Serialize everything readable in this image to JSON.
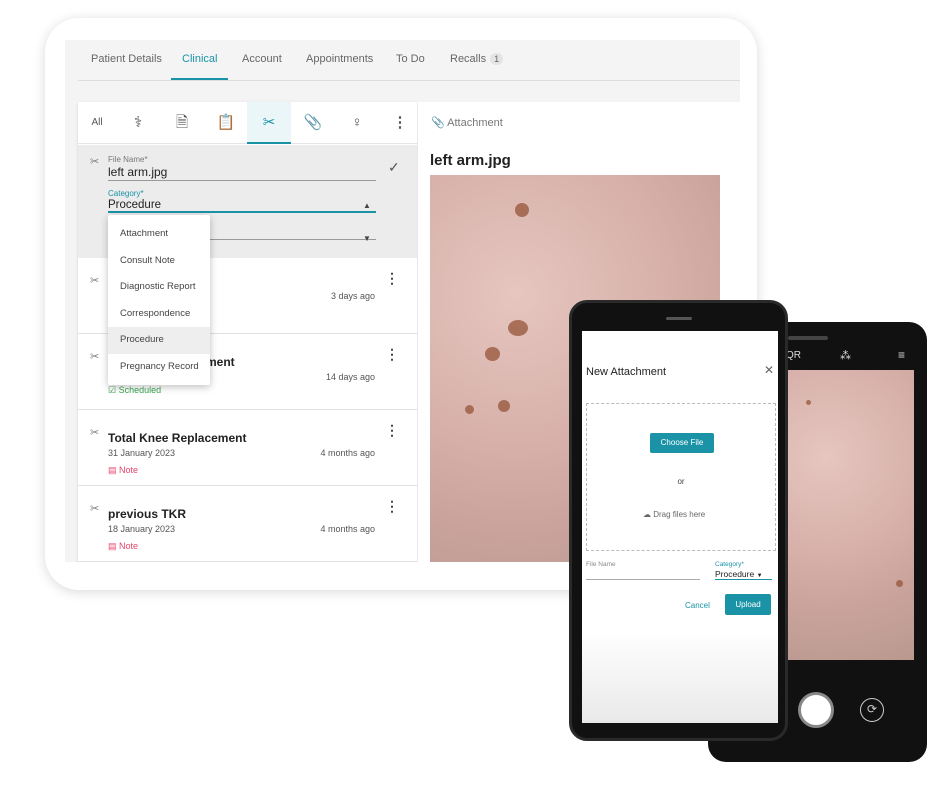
{
  "tabs": [
    {
      "label": "Patient Details"
    },
    {
      "label": "Clinical"
    },
    {
      "label": "Account"
    },
    {
      "label": "Appointments"
    },
    {
      "label": "To Do"
    },
    {
      "label": "Recalls",
      "badge": "1"
    }
  ],
  "filter": {
    "all": "All",
    "icons": [
      "stethoscope-icon",
      "document-icon",
      "clipboard-pulse-icon",
      "scissors-icon",
      "paperclip-icon",
      "pregnancy-icon",
      "more-vert-icon"
    ]
  },
  "edit": {
    "file_name_label": "File Name*",
    "file_name": "left arm.jpg",
    "category_label": "Category*",
    "category": "Procedure"
  },
  "dropdown": [
    "Attachment",
    "Consult Note",
    "Diagnostic Report",
    "Correspondence",
    "Procedure",
    "Pregnancy Record"
  ],
  "rows": [
    {
      "title": "",
      "date": "",
      "ago": "3 days ago",
      "tag": ""
    },
    {
      "title": "ment",
      "date": "",
      "ago": "14 days ago",
      "tag": "Scheduled"
    },
    {
      "title": "Total Knee Replacement",
      "date": "31 January 2023",
      "ago": "4 months ago",
      "tag": "Note"
    },
    {
      "title": "previous TKR",
      "date": "18 January 2023",
      "ago": "4 months ago",
      "tag": "Note"
    }
  ],
  "viewer": {
    "header": "Attachment",
    "filename": "left arm.jpg"
  },
  "phone": {
    "title": "New Attachment",
    "choose": "Choose File",
    "or": "or",
    "drag": "Drag files here",
    "file_name_label": "File Name",
    "category_label": "Category*",
    "category": "Procedure",
    "cancel": "Cancel",
    "upload": "Upload"
  },
  "camera": {
    "qr": "QR"
  },
  "colors": {
    "accent": "#1a93a7",
    "scheduled": "#3aa652",
    "note": "#e8456b"
  }
}
